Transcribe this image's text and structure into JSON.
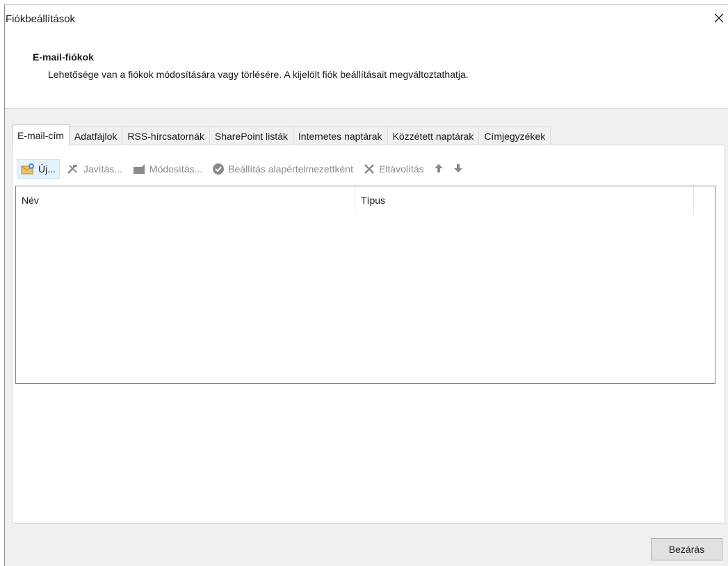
{
  "window": {
    "title": "Fiókbeállítások"
  },
  "header": {
    "heading": "E-mail-fiókok",
    "description": "Lehetősége van a fiókok módosítására vagy törlésére. A kijelölt fiók beállításait megváltoztathatja."
  },
  "tabs": [
    {
      "label": "E-mail-cím",
      "active": true
    },
    {
      "label": "Adatfájlok",
      "active": false
    },
    {
      "label": "RSS-hírcsatornák",
      "active": false
    },
    {
      "label": "SharePoint listák",
      "active": false
    },
    {
      "label": "Internetes naptárak",
      "active": false
    },
    {
      "label": "Közzétett naptárak",
      "active": false
    },
    {
      "label": "Címjegyzékek",
      "active": false
    }
  ],
  "toolbar": {
    "new_label": "Új...",
    "repair_label": "Javítás...",
    "change_label": "Módosítás...",
    "set_default_label": "Beállítás alapértelmezettként",
    "remove_label": "Eltávolítás"
  },
  "list": {
    "columns": [
      "Név",
      "Típus"
    ],
    "rows": []
  },
  "footer": {
    "close_label": "Bezárás"
  },
  "icons": {
    "new": "envelope-new-icon",
    "repair": "wrench-hammer-icon",
    "change": "edit-icon",
    "set_default": "checkmark-circle-icon",
    "remove": "x-remove-icon",
    "up": "arrow-up-icon",
    "down": "arrow-down-icon",
    "close": "close-icon"
  }
}
